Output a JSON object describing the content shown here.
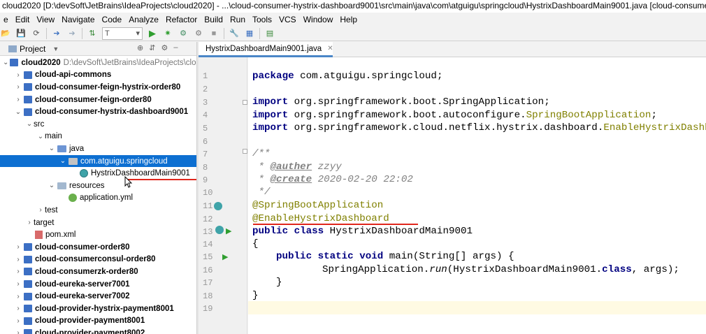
{
  "window": {
    "title": "cloud2020 [D:\\devSoft\\JetBrains\\IdeaProjects\\cloud2020] - ...\\cloud-consumer-hystrix-dashboard9001\\src\\main\\java\\com\\atguigu\\springcloud\\HystrixDashboardMain9001.java [cloud-consumer-hystrix-dashboard9001] - IntelliJ IDEA"
  },
  "menu": [
    "e",
    "Edit",
    "View",
    "Navigate",
    "Code",
    "Analyze",
    "Refactor",
    "Build",
    "Run",
    "Tools",
    "VCS",
    "Window",
    "Help"
  ],
  "toolbar": {
    "run_config": "T"
  },
  "project_panel": {
    "title": "Project",
    "tree": [
      {
        "label": "cloud2020",
        "path": "D:\\devSoft\\JetBrains\\IdeaProjects\\clou",
        "bold": true
      },
      {
        "label": "cloud-api-commons",
        "bold": true
      },
      {
        "label": "cloud-consumer-feign-hystrix-order80",
        "bold": true
      },
      {
        "label": "cloud-consumer-feign-order80",
        "bold": true
      },
      {
        "label": "cloud-consumer-hystrix-dashboard9001",
        "bold": true
      },
      {
        "label": "src"
      },
      {
        "label": "main"
      },
      {
        "label": "java"
      },
      {
        "label": "com.atguigu.springcloud"
      },
      {
        "label": "HystrixDashboardMain9001"
      },
      {
        "label": "resources"
      },
      {
        "label": "application.yml"
      },
      {
        "label": "test"
      },
      {
        "label": "target"
      },
      {
        "label": "pom.xml"
      },
      {
        "label": "cloud-consumer-order80",
        "bold": true
      },
      {
        "label": "cloud-consumerconsul-order80",
        "bold": true
      },
      {
        "label": "cloud-consumerzk-order80",
        "bold": true
      },
      {
        "label": "cloud-eureka-server7001",
        "bold": true
      },
      {
        "label": "cloud-eureka-server7002",
        "bold": true
      },
      {
        "label": "cloud-provider-hystrix-payment8001",
        "bold": true
      },
      {
        "label": "cloud-provider-payment8001",
        "bold": true
      },
      {
        "label": "cloud-provider-payment8002",
        "bold": true
      }
    ]
  },
  "editor": {
    "tab": "HystrixDashboardMain9001.java",
    "line_numbers": [
      "1",
      "2",
      "3",
      "4",
      "5",
      "6",
      "7",
      "8",
      "9",
      "10",
      "11",
      "12",
      "13",
      "14",
      "15",
      "16",
      "17",
      "18",
      "19"
    ],
    "code": {
      "l1_kw": "package",
      "l1_rest": " com.atguigu.springcloud;",
      "import_kw": "import",
      "l3_rest": " org.springframework.boot.SpringApplication;",
      "l4_rest": " org.springframework.boot.autoconfigure.",
      "l4_ann": "SpringBootApplication",
      "l4_end": ";",
      "l5_rest": " org.springframework.cloud.netflix.hystrix.dashboard.",
      "l5_ann": "EnableHystrixDashbo",
      "l7": "/**",
      "l8_pre": " * ",
      "l8_tag": "@auther",
      "l8_val": " zzyy",
      "l9_pre": " * ",
      "l9_tag": "@create",
      "l9_val": " 2020-02-20 22:02",
      "l10": " */",
      "l11": "@SpringBootApplication",
      "l12": "@EnableHystrixDashboard",
      "l13_kw": "public class",
      "l13_rest": " HystrixDashboardMain9001",
      "l14": "{",
      "l15_kw": "public static void",
      "l15_rest": " main(String[] args) {",
      "l16_pre": "SpringApplication.",
      "l16_it": "run",
      "l16_mid": "(HystrixDashboardMain9001.",
      "l16_kw": "class",
      "l16_end": ", args);",
      "l17": "}",
      "l18": "}"
    }
  }
}
